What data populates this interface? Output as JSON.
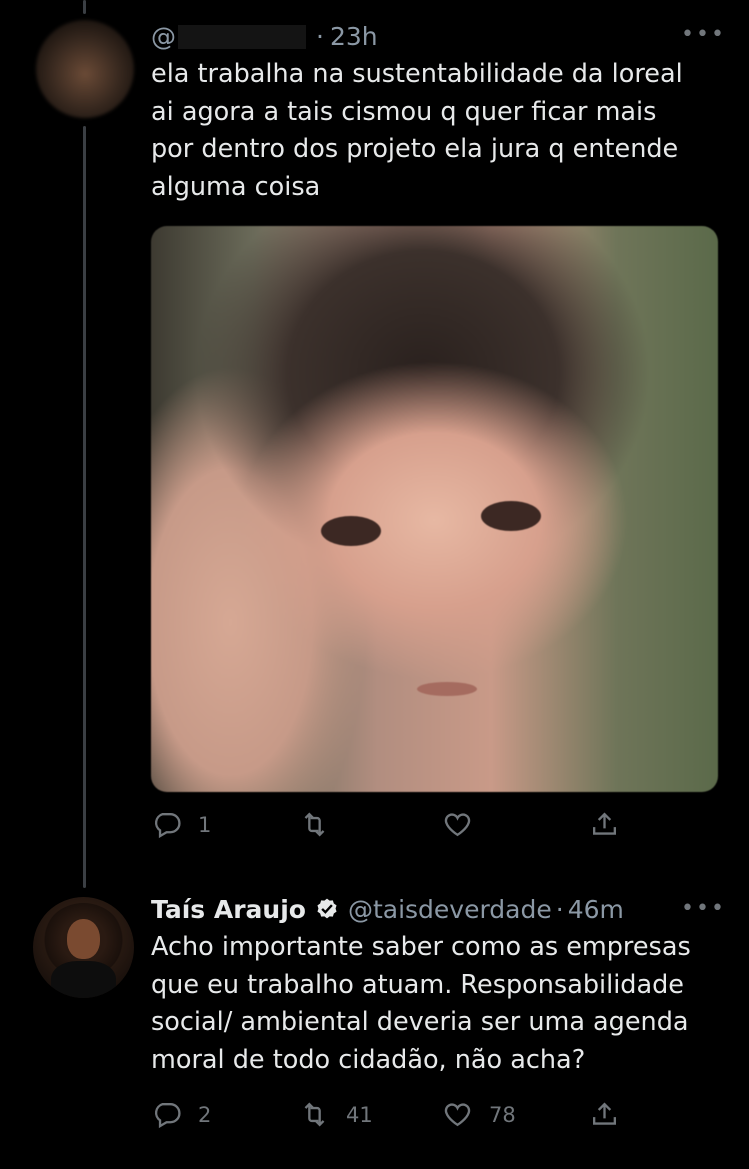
{
  "tweets": [
    {
      "handle_prefix": "@",
      "time": "23h",
      "more_label": "•••",
      "text": "ela trabalha na sustentabilidade da loreal\nai agora a tais cismou q quer ficar mais\npor dentro dos projeto ela jura q entende\nalguma coisa",
      "actions": {
        "reply_count": "1",
        "retweet_count": "",
        "like_count": ""
      }
    },
    {
      "name": "Taís Araujo",
      "handle": "@taisdeverdade",
      "time": "46m",
      "more_label": "•••",
      "text": "Acho importante saber como as empresas\nque eu trabalho atuam. Responsabilidade\nsocial/ ambiental  deveria ser uma agenda\nmoral de todo cidadão, não acha?",
      "actions": {
        "reply_count": "2",
        "retweet_count": "41",
        "like_count": "78"
      }
    }
  ],
  "colors": {
    "background": "#000000",
    "text": "#e7e9ea",
    "secondary": "#8b98a5",
    "verified": "#e7e9ea",
    "thread_line": "#3b3f44"
  },
  "icons": [
    "reply-icon",
    "retweet-icon",
    "like-icon",
    "share-icon",
    "verified-badge-icon",
    "more-icon"
  ]
}
